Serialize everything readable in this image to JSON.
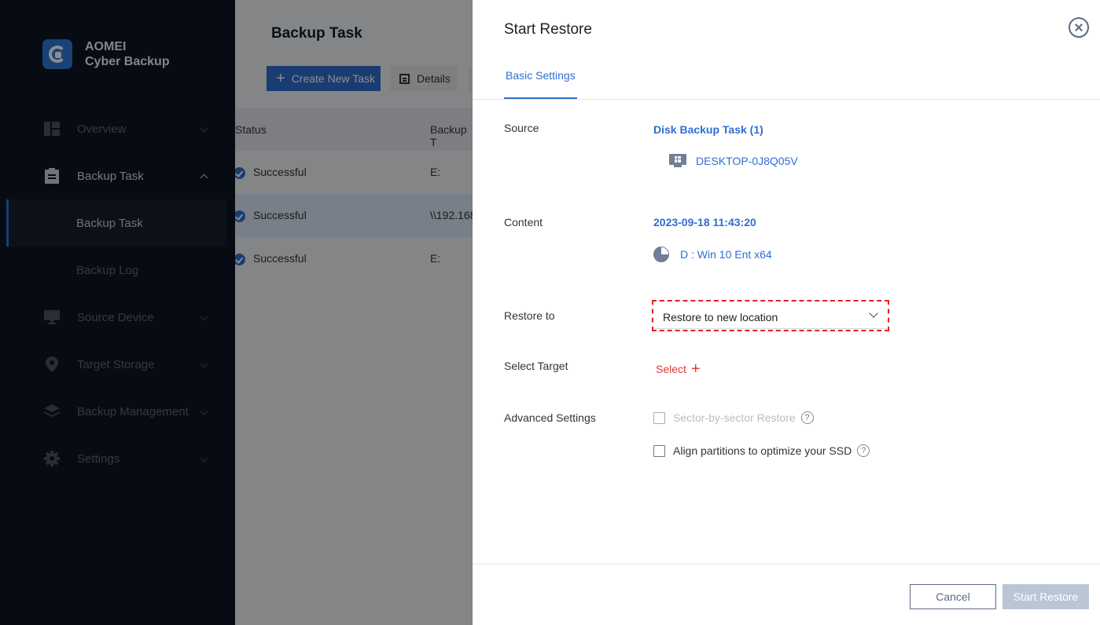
{
  "app": {
    "name_line1": "AOMEI",
    "name_line2": "Cyber Backup"
  },
  "sidebar": {
    "items": [
      {
        "label": "Overview",
        "icon": "overview-icon"
      },
      {
        "label": "Backup Task",
        "icon": "clipboard-icon"
      },
      {
        "label": "Source Device",
        "icon": "monitor-icon"
      },
      {
        "label": "Target Storage",
        "icon": "location-pin-icon"
      },
      {
        "label": "Backup Management",
        "icon": "layers-icon"
      },
      {
        "label": "Settings",
        "icon": "gear-icon"
      }
    ],
    "sub_items": [
      {
        "label": "Backup Task",
        "active": true
      },
      {
        "label": "Backup Log",
        "active": false
      }
    ]
  },
  "main": {
    "title": "Backup Task",
    "create_button": "Create New Task",
    "details_button": "Details",
    "columns": [
      "Status",
      "Backup T"
    ],
    "rows": [
      {
        "status": "Successful",
        "target": "E:"
      },
      {
        "status": "Successful",
        "target": "\\\\192.168"
      },
      {
        "status": "Successful",
        "target": "E:"
      }
    ]
  },
  "drawer": {
    "title": "Start Restore",
    "tab": "Basic Settings",
    "source_label": "Source",
    "source_task": "Disk Backup Task (1)",
    "source_device": "DESKTOP-0J8Q05V",
    "content_label": "Content",
    "content_time": "2023-09-18 11:43:20",
    "content_volume": "D : Win 10 Ent x64",
    "restore_to_label": "Restore to",
    "restore_to_value": "Restore to new location",
    "select_target_label": "Select Target",
    "select_target_link": "Select",
    "advanced_label": "Advanced Settings",
    "opt_sector": "Sector-by-sector Restore",
    "opt_align": "Align partitions to optimize your SSD",
    "cancel_button": "Cancel",
    "start_button": "Start Restore"
  },
  "colors": {
    "accent": "#2f6fd0",
    "sidebar_bg": "#0d1424",
    "highlight": "#e02020",
    "select_link": "#e53935"
  }
}
